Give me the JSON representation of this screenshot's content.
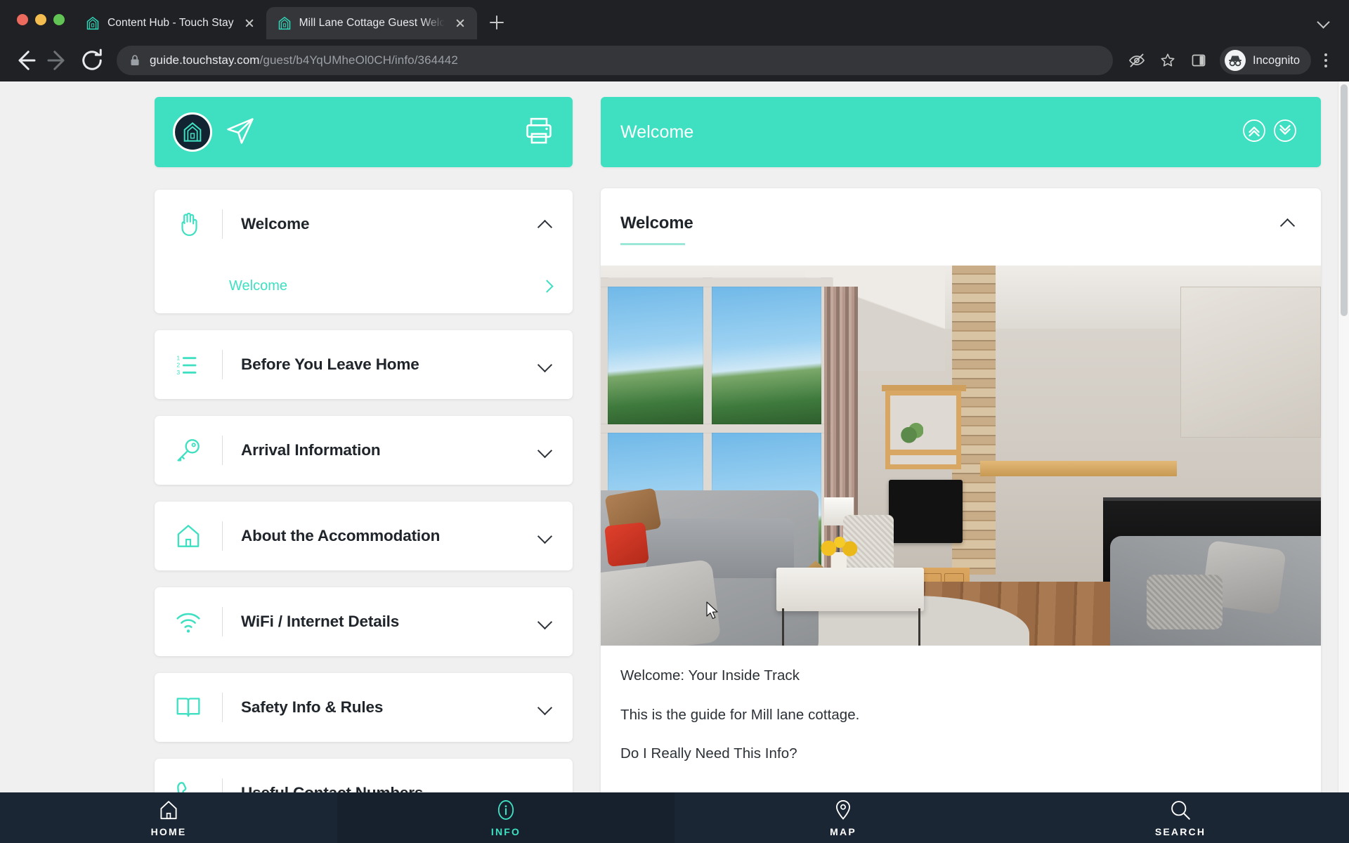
{
  "browser": {
    "tabs": [
      {
        "title": "Content Hub - Touch Stay",
        "active": false
      },
      {
        "title": "Mill Lane Cottage Guest Welco",
        "active": true
      }
    ],
    "new_tab_label": "+",
    "url": {
      "domain": "guide.touchstay.com",
      "path": "/guest/b4YqUMheOl0CH/info/364442"
    },
    "profile_label": "Incognito",
    "accent_color": "#3FE0C2"
  },
  "guide": {
    "brandbar": {
      "logo_name": "touch-stay-house-logo",
      "send_icon": "paper-plane-icon",
      "print_icon": "printer-icon"
    },
    "sections": [
      {
        "label": "Welcome",
        "icon": "waving-hand-icon",
        "expanded": true,
        "subitems": [
          {
            "label": "Welcome"
          }
        ]
      },
      {
        "label": "Before You Leave Home",
        "icon": "numbered-list-icon",
        "expanded": false,
        "subitems": []
      },
      {
        "label": "Arrival Information",
        "icon": "key-icon",
        "expanded": false,
        "subitems": []
      },
      {
        "label": "About the Accommodation",
        "icon": "house-icon",
        "expanded": false,
        "subitems": []
      },
      {
        "label": "WiFi / Internet Details",
        "icon": "wifi-icon",
        "expanded": false,
        "subitems": []
      },
      {
        "label": "Safety Info & Rules",
        "icon": "open-book-icon",
        "expanded": false,
        "subitems": []
      },
      {
        "label": "Useful Contact Numbers",
        "icon": "phone-icon",
        "expanded": false,
        "subitems": []
      }
    ],
    "panel": {
      "header_title": "Welcome",
      "collapse_all_icon": "double-chevron-up-icon",
      "expand_all_icon": "double-chevron-down-icon",
      "article_title": "Welcome",
      "hero_alt": "living-room-with-fireplace-and-forest-view",
      "paragraphs": [
        "Welcome: Your Inside Track",
        "This is the guide for Mill lane cottage.",
        "Do I Really Need This Info?"
      ]
    },
    "bottomnav": [
      {
        "label": "HOME",
        "icon": "home-icon",
        "active": false
      },
      {
        "label": "INFO",
        "icon": "info-icon",
        "active": true
      },
      {
        "label": "MAP",
        "icon": "map-pin-icon",
        "active": false
      },
      {
        "label": "SEARCH",
        "icon": "search-icon",
        "active": false
      }
    ]
  }
}
